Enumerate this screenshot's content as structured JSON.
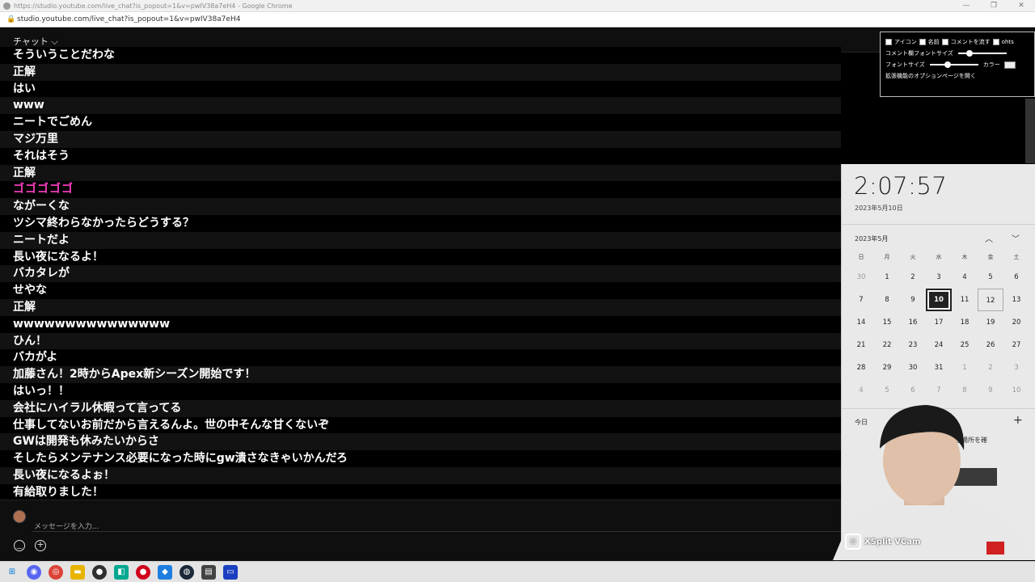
{
  "window": {
    "title": "https://studio.youtube.com/live_chat?is_popout=1&v=pwIV38a7eH4 - Google Chrome",
    "url": "studio.youtube.com/live_chat?is_popout=1&v=pwIV38a7eH4",
    "controls": [
      "—",
      "❐",
      "✕"
    ]
  },
  "chat": {
    "header_label": "チャット ⌵",
    "messages": [
      "そういうことだわな",
      "正解",
      "はい",
      "www",
      "ニートでごめん",
      "マジ万里",
      "それはそう",
      "正解",
      "ゴゴゴゴゴ",
      "ながーくな",
      "ツシマ終わらなかったらどうする？",
      "ニートだよ",
      "長い夜になるよ！",
      "バカタレが",
      "せやな",
      "正解",
      "wwwwwwwwwwwwwww",
      "ひん！",
      "バカがよ",
      "加藤さん！2時からApex新シーズン開始です！",
      "はいっ！！",
      "会社にハイラル休暇って言ってる",
      "仕事してないお前だから言えるんよ。世の中そんな甘くないぞ",
      "GWは開発も休みたいからさ",
      "そしたらメンテナンス必要になった時にgw潰さなきゃいかんだろ",
      "長い夜になるよぉ！",
      "有給取りました！"
    ],
    "input_placeholder": "メッセージを入力..."
  },
  "extension": {
    "checkboxes": [
      "アイコン",
      "名前",
      "コメントを流す",
      "ohts"
    ],
    "comment_font_label": "コメント欄フォントサイズ",
    "comment_font_level": 0.2,
    "font_size_label": "フォントサイズ",
    "font_size_level": 0.35,
    "color_label": "カラー",
    "options_link": "拡張機能のオプションページを開く"
  },
  "calendar": {
    "time": "2:07:57",
    "date": "2023年5月10日",
    "month": "2023年5月",
    "weekdays": [
      "日",
      "月",
      "火",
      "水",
      "木",
      "金",
      "土"
    ],
    "weeks": [
      [
        "30",
        "1",
        "2",
        "3",
        "4",
        "5",
        "6"
      ],
      [
        "7",
        "8",
        "9",
        "10",
        "11",
        "12",
        "13"
      ],
      [
        "14",
        "15",
        "16",
        "17",
        "18",
        "19",
        "20"
      ],
      [
        "21",
        "22",
        "23",
        "24",
        "25",
        "26",
        "27"
      ],
      [
        "28",
        "29",
        "30",
        "31",
        "1",
        "2",
        "3"
      ],
      [
        "4",
        "5",
        "6",
        "7",
        "8",
        "9",
        "10"
      ]
    ],
    "today_label": "今日",
    "event_text": "き場所を確"
  },
  "overlay": {
    "vcam_label": "XSplit VCam"
  },
  "taskbar": {
    "icons": [
      "windows-start",
      "discord",
      "chrome",
      "file-explorer",
      "obs",
      "app-cyan",
      "app-red",
      "app-blue",
      "steam",
      "ncv",
      "monitor"
    ]
  }
}
